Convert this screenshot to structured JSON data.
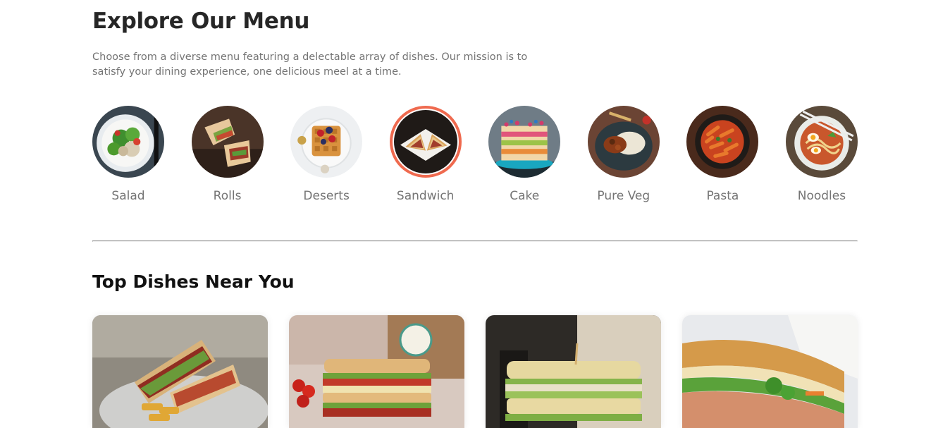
{
  "header": {
    "title": "Explore Our Menu",
    "description": "Choose from a diverse menu featuring a delectable array of dishes. Our mission is to satisfy your dining experience, one delicious meel at a time."
  },
  "menu": {
    "items": [
      {
        "label": "Salad",
        "icon": "salad-image"
      },
      {
        "label": "Rolls",
        "icon": "rolls-image"
      },
      {
        "label": "Deserts",
        "icon": "deserts-image"
      },
      {
        "label": "Sandwich",
        "icon": "sandwich-image",
        "active": true
      },
      {
        "label": "Cake",
        "icon": "cake-image"
      },
      {
        "label": "Pure Veg",
        "icon": "pure-veg-image"
      },
      {
        "label": "Pasta",
        "icon": "pasta-image"
      },
      {
        "label": "Noodles",
        "icon": "noodles-image"
      }
    ],
    "active_color": "#ef6a4f"
  },
  "dishes": {
    "title": "Top Dishes Near You"
  }
}
